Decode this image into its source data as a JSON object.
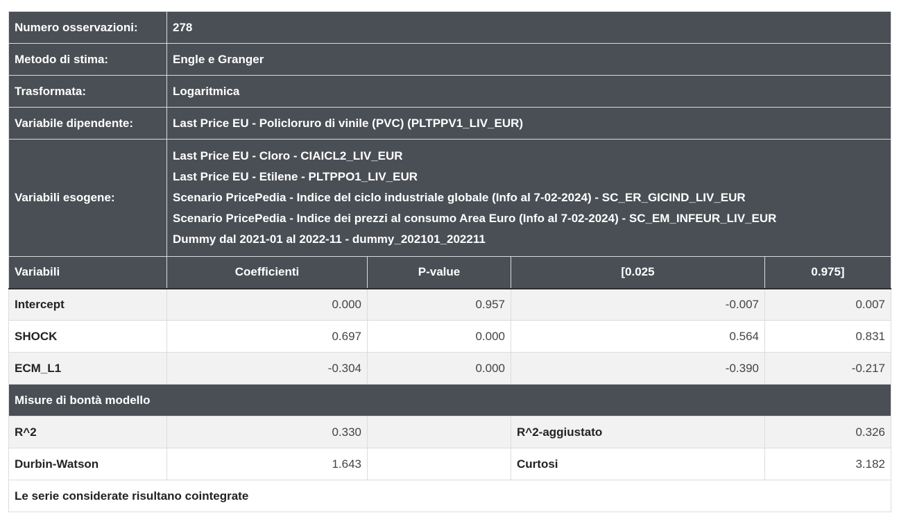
{
  "info": {
    "observations_label": "Numero osservazioni:",
    "observations_value": "278",
    "method_label": "Metodo di stima:",
    "method_value": "Engle e Granger",
    "transform_label": "Trasformata:",
    "transform_value": "Logaritmica",
    "dependent_label": "Variabile dipendente:",
    "dependent_value": "Last Price EU - Policloruro di vinile (PVC) (PLTPPV1_LIV_EUR)",
    "exogenous_label": "Variabili esogene:",
    "exogenous_values": [
      "Last Price EU - Cloro - CIAICL2_LIV_EUR",
      "Last Price EU - Etilene - PLTPPO1_LIV_EUR",
      "Scenario PricePedia - Indice del ciclo industriale globale (Info al 7-02-2024) - SC_ER_GICIND_LIV_EUR",
      "Scenario PricePedia - Indice dei prezzi al consumo Area Euro (Info al 7-02-2024) - SC_EM_INFEUR_LIV_EUR",
      "Dummy dal 2021-01 al 2022-11 - dummy_202101_202211"
    ]
  },
  "coefficients": {
    "headers": [
      "Variabili",
      "Coefficienti",
      "P-value",
      "[0.025",
      "0.975]"
    ],
    "rows": [
      {
        "name": "Intercept",
        "coef": "0.000",
        "pvalue": "0.957",
        "low": "-0.007",
        "high": "0.007"
      },
      {
        "name": "SHOCK",
        "coef": "0.697",
        "pvalue": "0.000",
        "low": "0.564",
        "high": "0.831"
      },
      {
        "name": "ECM_L1",
        "coef": "-0.304",
        "pvalue": "0.000",
        "low": "-0.390",
        "high": "-0.217"
      }
    ]
  },
  "goodness": {
    "title": "Misure di bontà modello",
    "rows": [
      {
        "label1": "R^2",
        "value1": "0.330",
        "label2": "R^2-aggiustato",
        "value2": "0.326"
      },
      {
        "label1": "Durbin-Watson",
        "value1": "1.643",
        "label2": "Curtosi",
        "value2": "3.182"
      }
    ]
  },
  "conclusion": "Le serie considerate risultano cointegrate",
  "colors": {
    "header_bg": "#4a4f55",
    "row_alt_bg": "#f2f2f2",
    "row_bg": "#ffffff"
  }
}
